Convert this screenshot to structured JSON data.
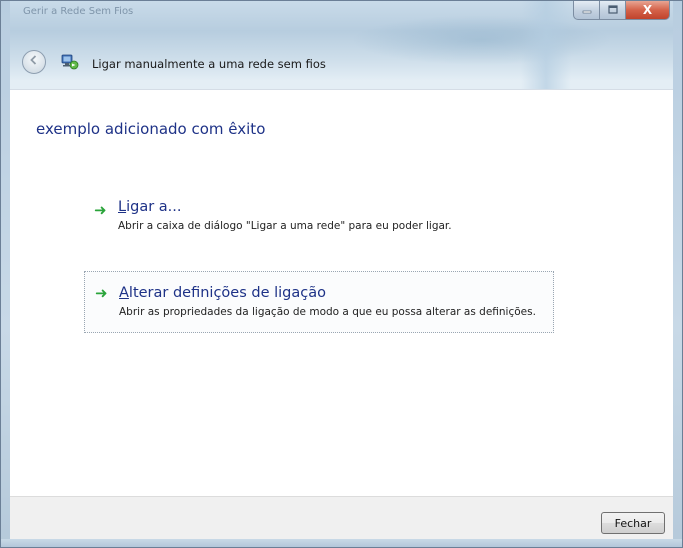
{
  "window": {
    "title": "Gerir a Rede Sem Fios",
    "caption": {
      "minimize_icon": "minimize-icon",
      "maximize_icon": "maximize-icon",
      "close_glyph": "X"
    }
  },
  "nav": {
    "back_icon": "back-arrow-icon",
    "app_icon": "wireless-network-icon",
    "title": "Ligar manualmente a uma rede sem fios"
  },
  "main": {
    "heading": "exemplo adicionado com êxito",
    "commands": [
      {
        "accel": "L",
        "title_rest": "igar a...",
        "description": "Abrir a caixa de diálogo \"Ligar a uma rede\" para eu poder ligar."
      },
      {
        "accel": "A",
        "title_rest": "lterar definições de ligação",
        "description": "Abrir as propriedades da ligação de modo a que eu possa alterar as definições."
      }
    ],
    "command_icon": "green-arrow-icon"
  },
  "footer": {
    "close_label": "Fechar"
  },
  "colors": {
    "link": "#1e3287",
    "arrow": "#2aa43a",
    "close_button": "#c0432c"
  }
}
